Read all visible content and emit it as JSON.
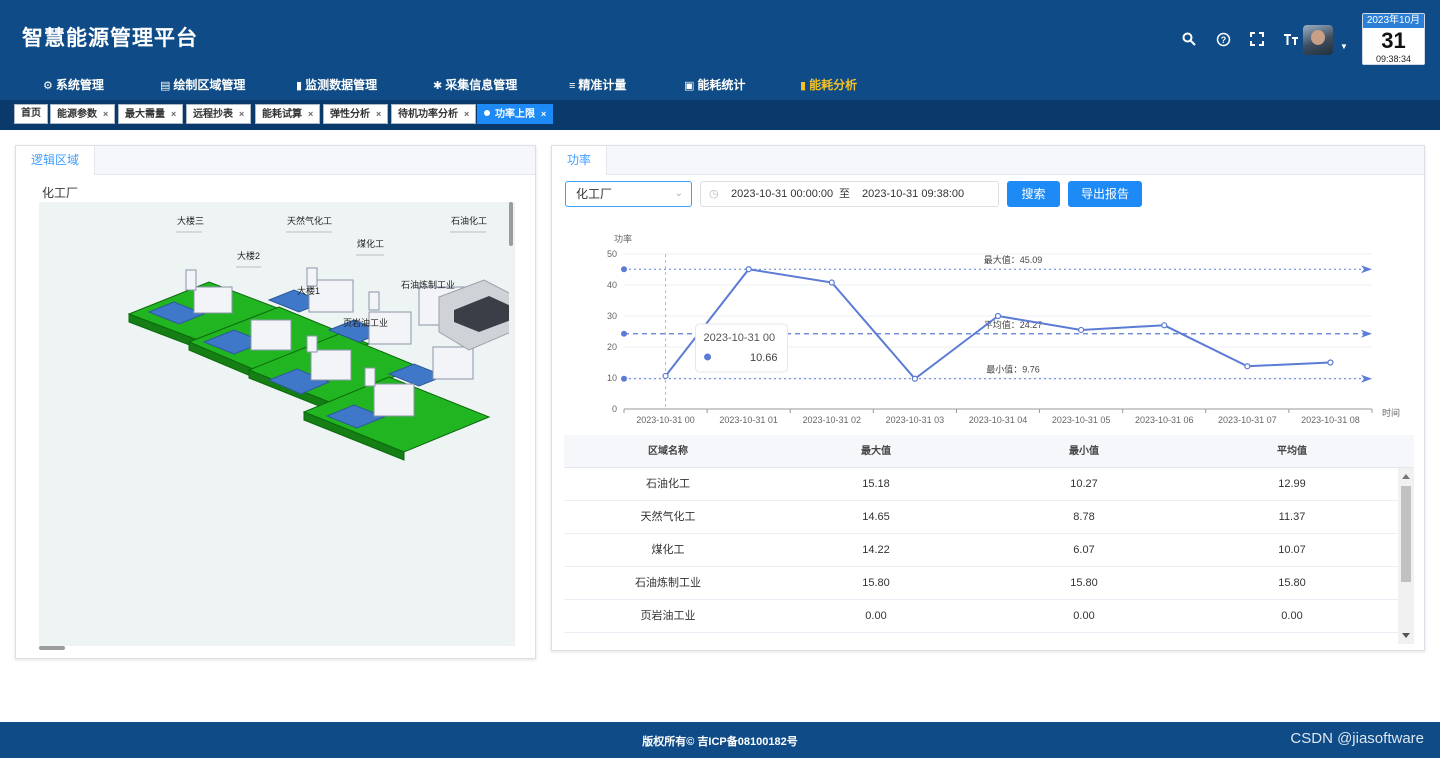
{
  "header": {
    "brand": "智慧能源管理平台",
    "icons": [
      "search-icon",
      "help-icon",
      "fullscreen-icon",
      "font-size-icon"
    ],
    "calendar": {
      "month": "2023年10月",
      "day": "31",
      "time": "09:38:34"
    }
  },
  "nav": [
    {
      "label": "系统管理",
      "icon": "⚙"
    },
    {
      "label": "绘制区域管理",
      "icon": "▤"
    },
    {
      "label": "监测数据管理",
      "icon": "▮"
    },
    {
      "label": "采集信息管理",
      "icon": "✱"
    },
    {
      "label": "精准计量",
      "icon": "≡"
    },
    {
      "label": "能耗统计",
      "icon": "▣"
    },
    {
      "label": "能耗分析",
      "icon": "▮",
      "active": true
    }
  ],
  "tabs": [
    {
      "label": "首页"
    },
    {
      "label": "能源参数",
      "closable": true
    },
    {
      "label": "最大需量",
      "closable": true
    },
    {
      "label": "远程抄表",
      "closable": true
    },
    {
      "label": "能耗试算",
      "closable": true
    },
    {
      "label": "弹性分析",
      "closable": true
    },
    {
      "label": "待机功率分析",
      "closable": true
    },
    {
      "label": "功率上限",
      "closable": true,
      "active": true
    }
  ],
  "left_panel": {
    "tab": "逻辑区域",
    "area_name": "化工厂",
    "map_labels": [
      "大楼三",
      "天然气化工",
      "石油化工",
      "煤化工",
      "大楼2",
      "石油炼制工业",
      "大楼1",
      "页岩油工业"
    ]
  },
  "right_panel": {
    "tab": "功率",
    "select_value": "化工厂",
    "date_start": "2023-10-31 00:00:00",
    "date_sep": "至",
    "date_end": "2023-10-31 09:38:00",
    "search_label": "搜索",
    "export_label": "导出报告",
    "tooltip": {
      "title": "2023-10-31 00",
      "value": "10.66"
    }
  },
  "chart_data": {
    "type": "line",
    "ylabel": "功率",
    "xlabel": "时间",
    "ylim": [
      0,
      50
    ],
    "yticks": [
      0,
      10,
      20,
      30,
      40,
      50
    ],
    "categories": [
      "2023-10-31 00",
      "2023-10-31 01",
      "2023-10-31 02",
      "2023-10-31 03",
      "2023-10-31 04",
      "2023-10-31 05",
      "2023-10-31 06",
      "2023-10-31 07",
      "2023-10-31 08"
    ],
    "values": [
      10.66,
      45.09,
      40.8,
      9.76,
      30.0,
      25.5,
      27.0,
      13.8,
      15.0
    ],
    "color": "#5b7bd5",
    "mark_lines": [
      {
        "label": "最大值：45.09",
        "value": 45.09
      },
      {
        "label": "平均值：24.27",
        "value": 24.27
      },
      {
        "label": "最小值：9.76",
        "value": 9.76
      }
    ]
  },
  "table": {
    "columns": [
      "区域名称",
      "最大值",
      "最小值",
      "平均值"
    ],
    "rows": [
      [
        "石油化工",
        "15.18",
        "10.27",
        "12.99"
      ],
      [
        "天然气化工",
        "14.65",
        "8.78",
        "11.37"
      ],
      [
        "煤化工",
        "14.22",
        "6.07",
        "10.07"
      ],
      [
        "石油炼制工业",
        "15.80",
        "15.80",
        "15.80"
      ],
      [
        "页岩油工业",
        "0.00",
        "0.00",
        "0.00"
      ]
    ]
  },
  "footer": {
    "copyright": "版权所有© 吉ICP备08100182号",
    "watermark": "CSDN @jiasoftware"
  }
}
